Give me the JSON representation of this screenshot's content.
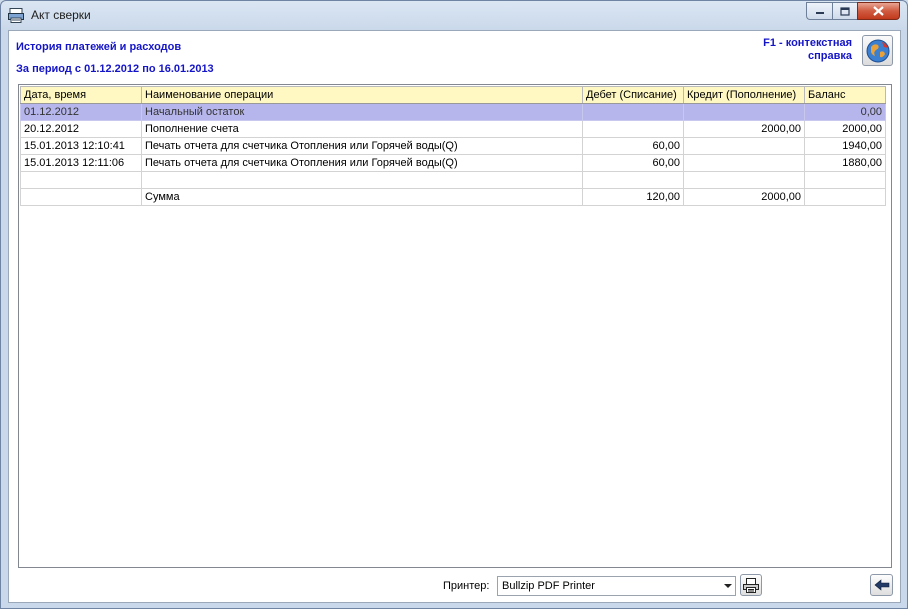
{
  "window": {
    "title": "Акт сверки"
  },
  "header": {
    "heading": "История платежей и расходов",
    "period": "За период с 01.12.2012 по 16.01.2013",
    "help_line1": "F1 - контекстная",
    "help_line2": "справка"
  },
  "table": {
    "columns": [
      "Дата, время",
      "Наименование операции",
      "Дебет (Списание)",
      "Кредит (Пополнение)",
      "Баланс"
    ],
    "rows": [
      {
        "date": "01.12.2012",
        "name": "Начальный остаток",
        "debit": "",
        "credit": "",
        "balance": "0,00"
      },
      {
        "date": "20.12.2012",
        "name": "Пополнение счета",
        "debit": "",
        "credit": "2000,00",
        "balance": "2000,00"
      },
      {
        "date": "15.01.2013 12:10:41",
        "name": "Печать отчета для счетчика Отопления или Горячей воды(Q)",
        "debit": "60,00",
        "credit": "",
        "balance": "1940,00"
      },
      {
        "date": "15.01.2013 12:11:06",
        "name": "Печать отчета для счетчика Отопления или Горячей воды(Q)",
        "debit": "60,00",
        "credit": "",
        "balance": "1880,00"
      },
      {
        "date": "",
        "name": "",
        "debit": "",
        "credit": "",
        "balance": ""
      },
      {
        "date": "",
        "name": "Сумма",
        "debit": "120,00",
        "credit": "2000,00",
        "balance": ""
      }
    ]
  },
  "footer": {
    "printer_label": "Принтер:",
    "printer_value": "Bullzip PDF Printer"
  },
  "colors": {
    "header_text": "#1515c8",
    "grid_header_bg": "#fff8c2",
    "selected_row_bg": "#b6b6ec",
    "close_button": "#c2391d"
  },
  "icons": {
    "app": "report-icon",
    "help": "globe-help-icon",
    "print": "printer-icon",
    "back": "arrow-left-icon"
  }
}
